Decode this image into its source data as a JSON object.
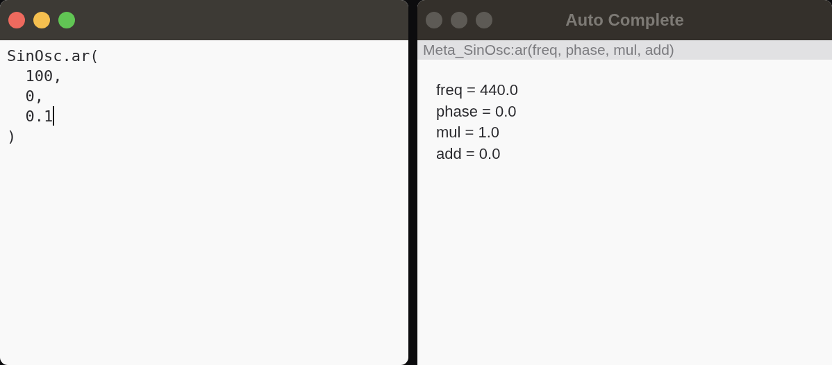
{
  "editor_window": {
    "active": true,
    "code_lines": [
      "SinOsc.ar(",
      "  100,",
      "  0,",
      "  0.1",
      ")"
    ]
  },
  "autocomplete_window": {
    "title": "Auto Complete",
    "active": false,
    "signature": "Meta_SinOsc:ar(freq, phase, mul, add)",
    "arguments": [
      "freq = 440.0",
      "phase = 0.0",
      "mul = 1.0",
      "add = 0.0"
    ]
  }
}
